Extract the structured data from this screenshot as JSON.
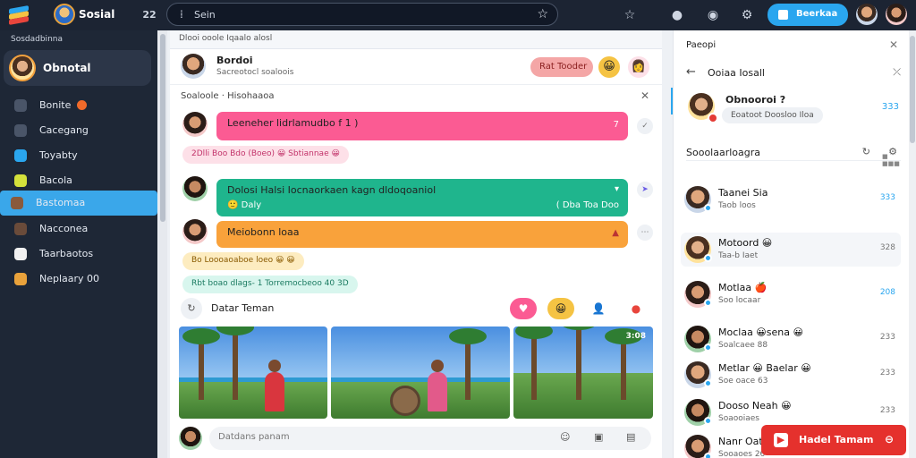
{
  "topbar": {
    "brand": "Sosial",
    "nav_glyph": "22",
    "search_placeholder": "Sein",
    "action_button": "Beerkaa"
  },
  "sidebar": {
    "heading": "Sosdadbinna",
    "profile_name": "Obnotal",
    "items": [
      {
        "label": "Bonite",
        "icon_color": "#4a5568",
        "badge": true
      },
      {
        "label": "Cacegang",
        "icon_color": "#4a5568"
      },
      {
        "label": "Toyabty",
        "icon_color": "#2aa6ef"
      },
      {
        "label": "Bacola",
        "icon_color": "#d4e13b"
      },
      {
        "label": "Bastomaa",
        "icon_color": "#8a5a3c",
        "active": true
      },
      {
        "label": "Nacconea",
        "icon_color": "#6a4b3a"
      },
      {
        "label": "Taarbaotos",
        "icon_color": "#f1f1f1"
      },
      {
        "label": "Neplaary 00",
        "icon_color": "#e9a23b"
      }
    ]
  },
  "feed": {
    "breadcrumb": "Dlooi ooole Iqaalo alosl",
    "post": {
      "title": "Bordoi",
      "subtitle": "Sacreotocl soaloois",
      "button": "Rat Tooder"
    },
    "thread": {
      "label": "Soaloole  ·  Hisohaaoa"
    },
    "messages": [
      {
        "text": "Leeneher lidrlamudbo  f 1 )",
        "meta": "7",
        "color": "#fb5b93"
      },
      {
        "chip": "2Dlli Boo Bdo (Boeo) 😀 Sbtiannae 😀",
        "chip_color": "#fde0e8"
      },
      {
        "text": "Dolosi Halsi Iocnaorkaen kagn dldoqoaniol",
        "sub": "🙂 Daly",
        "meta": "( Dba Toa Doo",
        "color": "#1fb58d"
      },
      {
        "text": "Meiobonn loaa",
        "meta": "▲",
        "color": "#f9a23b"
      },
      {
        "chip": "Bo Loooaoaboe loeo 😀 😀",
        "chip_color": "#fdecc0"
      },
      {
        "chip": "Rbt boao dlags- 1 Torremocbeoo 40 3D",
        "chip_color": "#d8f6ee"
      }
    ],
    "gallery": {
      "label": "Datar Teman",
      "photo_tag": "3:08"
    },
    "composer_placeholder": "Datdans panam"
  },
  "right_panel": {
    "header": "Paeopi",
    "title": "Ooiaa Iosall",
    "focus": {
      "name": "Obnooroi ?",
      "snippet": "Eoatoot Doosloo Iloa",
      "time": "333"
    },
    "section": "Sooolaarloagra",
    "section_sub": "■ ■■■",
    "contacts": [
      {
        "name": "Taanei Sia",
        "snippet": "Taob loos",
        "time": "333",
        "blue": true
      },
      {
        "name": "Motoord 😀",
        "snippet": "Taa-b  Iaet",
        "time": "328"
      },
      {
        "name": "Motlaa 🍎",
        "snippet": "Soo locaar",
        "time": "208",
        "blue": true
      },
      {
        "name": "Moclaa 😀sena 😀",
        "snippet": "Soalcaee 88",
        "time": "233"
      },
      {
        "name": "Metlar 😀 Baelar 😀",
        "snippet": "Soe oace 63",
        "time": "233"
      },
      {
        "name": "Dooso Neah 😀",
        "snippet": "Soaooiaes",
        "time": "233"
      },
      {
        "name": "Nanr Oata",
        "snippet": "Sooaoes 26",
        "time": ""
      }
    ],
    "cta": "Hadel Tamam"
  }
}
